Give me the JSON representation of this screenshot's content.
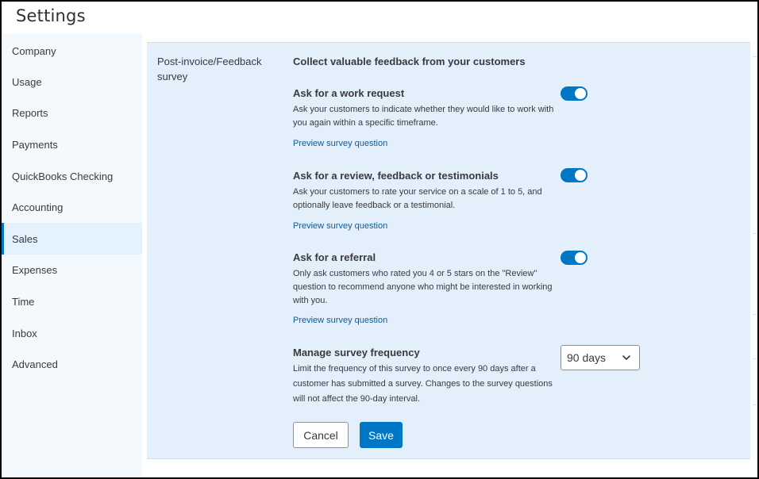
{
  "page": {
    "title": "Settings"
  },
  "sidebar": {
    "items": [
      {
        "label": "Company"
      },
      {
        "label": "Usage"
      },
      {
        "label": "Reports"
      },
      {
        "label": "Payments"
      },
      {
        "label": "QuickBooks Checking"
      },
      {
        "label": "Accounting"
      },
      {
        "label": "Sales",
        "active": true
      },
      {
        "label": "Expenses"
      },
      {
        "label": "Time"
      },
      {
        "label": "Inbox"
      },
      {
        "label": "Advanced"
      }
    ]
  },
  "survey": {
    "section_label": "Post-invoice/Feedback survey",
    "heading": "Collect valuable feedback from your customers",
    "options": [
      {
        "title": "Ask for a work request",
        "description": "Ask your customers to indicate whether they would like to work with you again within a specific timeframe.",
        "link": "Preview survey question",
        "enabled": true
      },
      {
        "title": "Ask for a review, feedback or testimonials",
        "description": "Ask your customers to rate your service on a scale of 1 to 5, and optionally leave feedback or a testimonial.",
        "link": "Preview survey question",
        "enabled": true
      },
      {
        "title": "Ask for a referral",
        "description": "Only ask customers who rated you 4 or 5 stars on the \"Review\" question to recommend anyone who might be interested in working with you.",
        "link": "Preview survey question",
        "enabled": true
      }
    ],
    "frequency": {
      "title": "Manage survey frequency",
      "description": "Limit the frequency of this survey to once every 90 days after a customer has submitted a survey. Changes to the survey questions will not affect the 90-day interval.",
      "selected": "90 days"
    },
    "buttons": {
      "cancel": "Cancel",
      "save": "Save"
    }
  },
  "colors": {
    "accent": "#0077c5",
    "panel_bg": "#e3effb",
    "sidebar_bg": "#f4f9fd",
    "link": "#0d5c98"
  }
}
